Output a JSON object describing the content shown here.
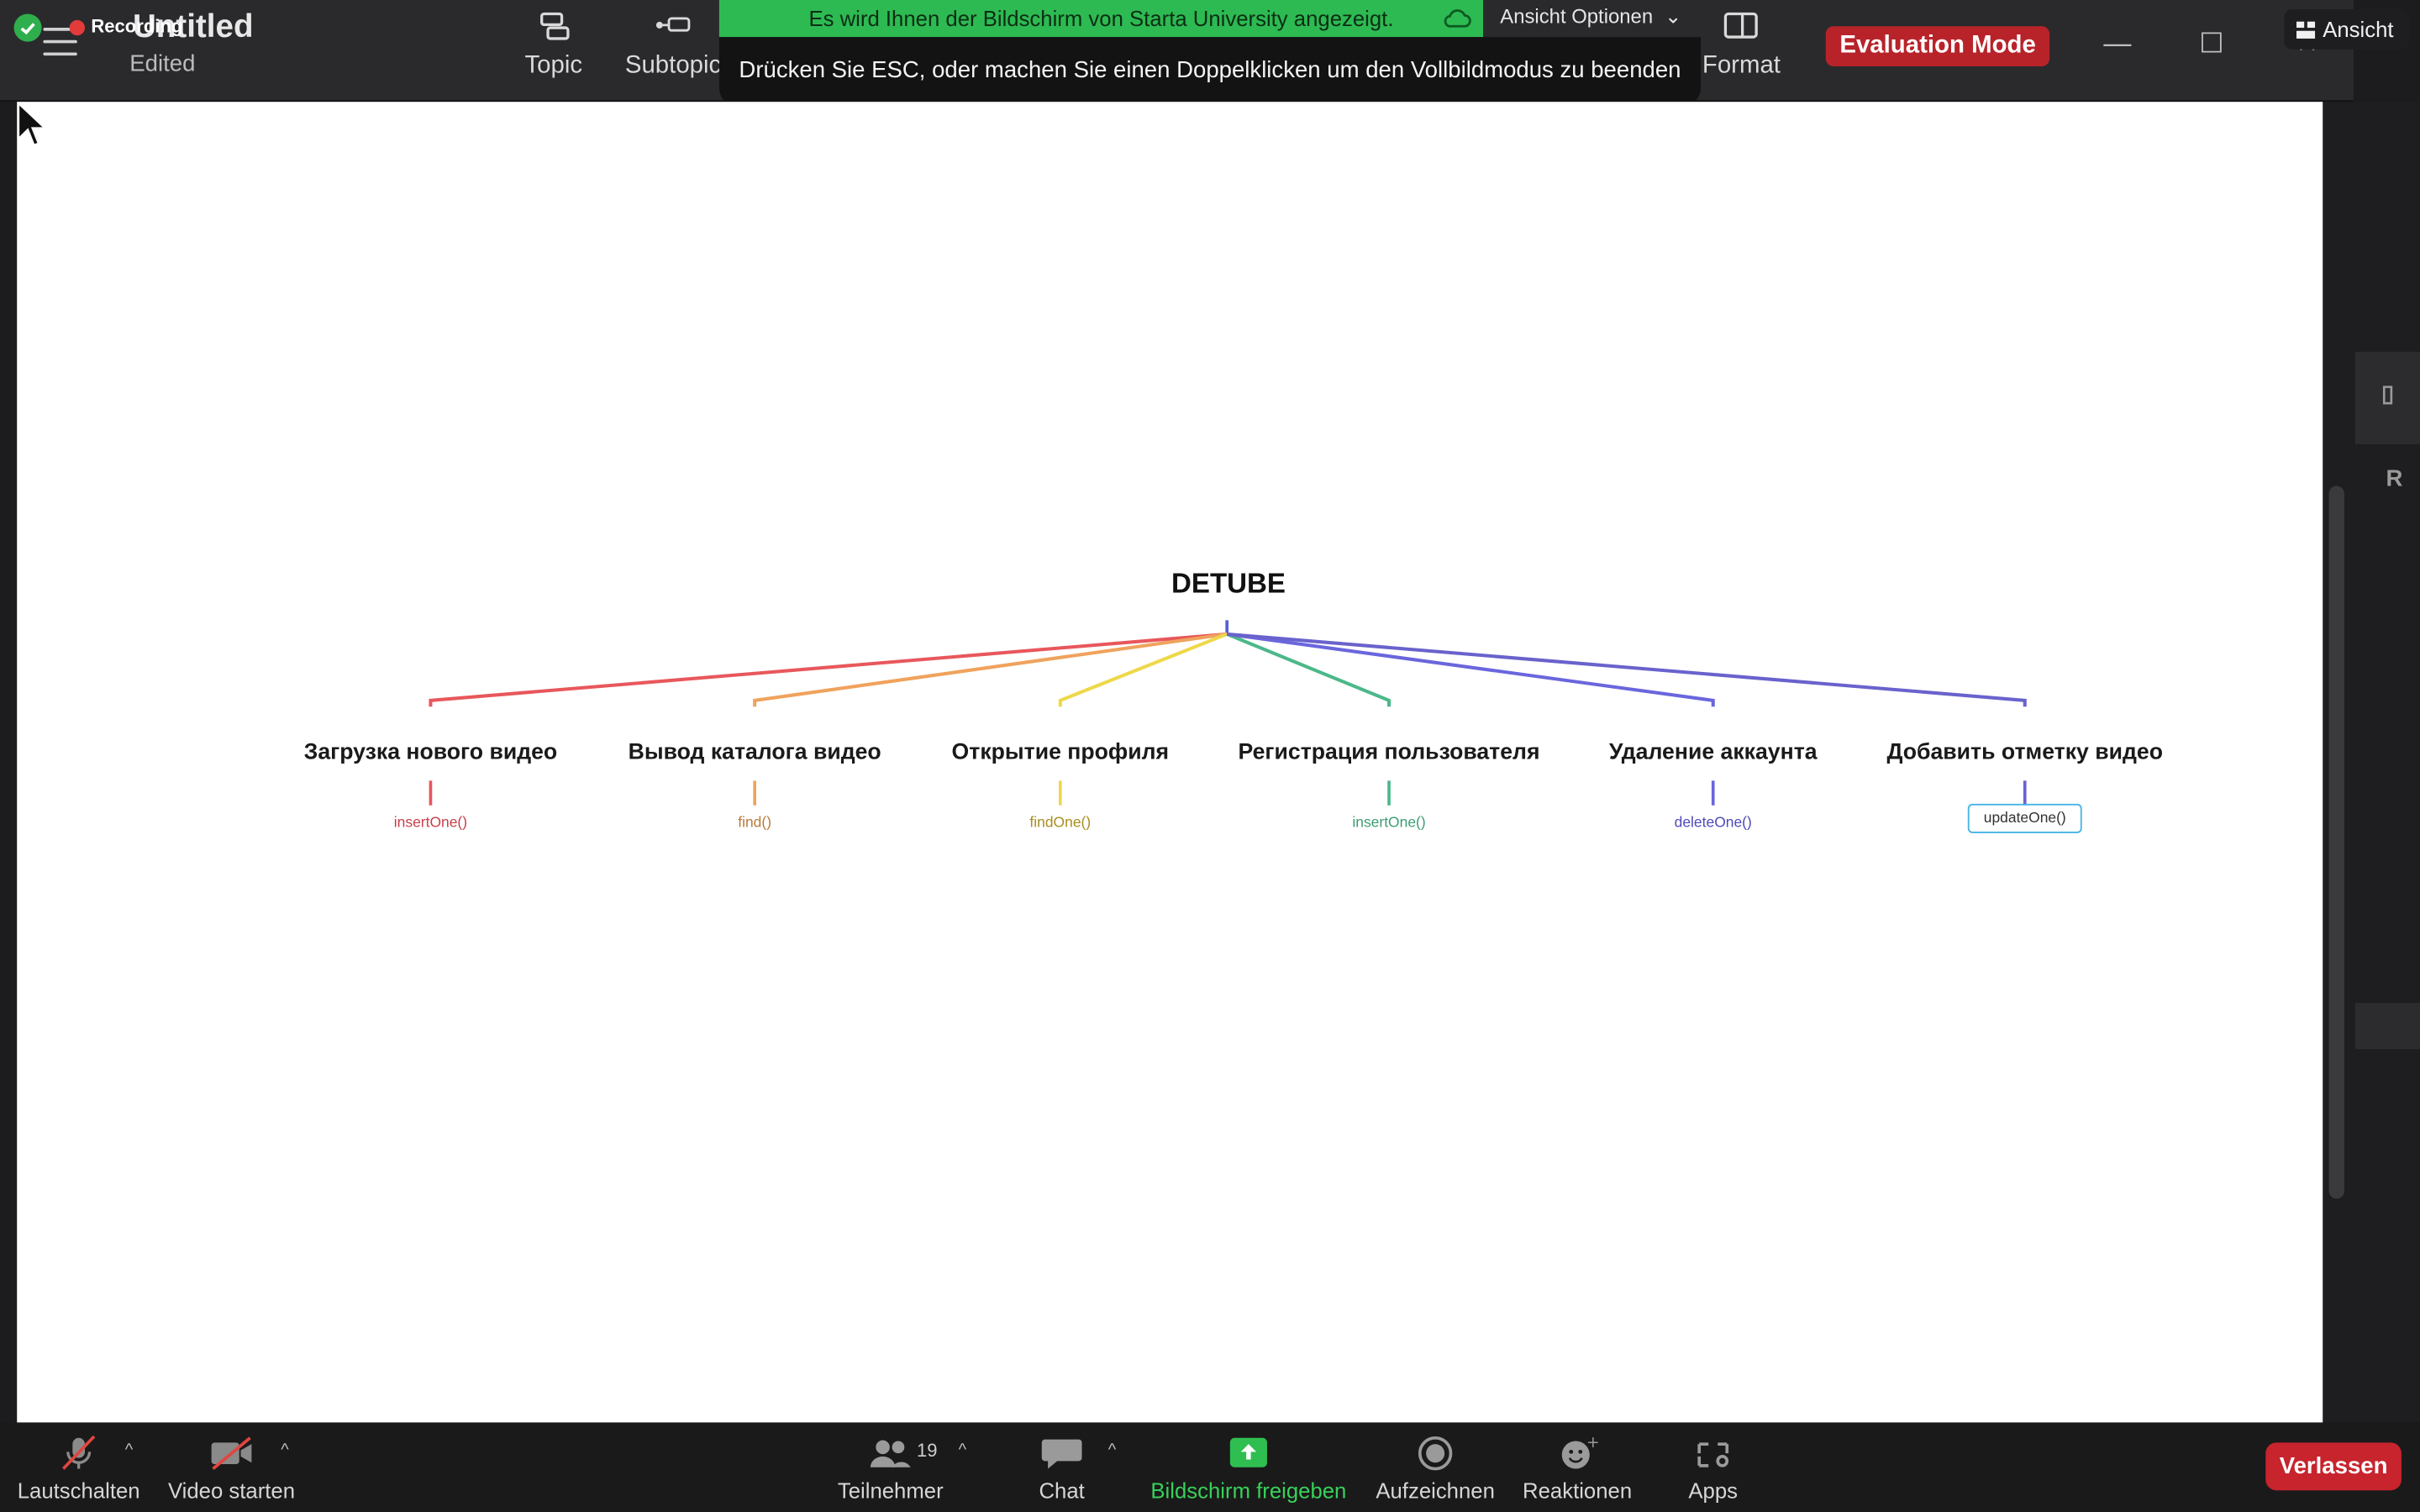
{
  "zoom": {
    "recording_label": "Recording",
    "share_banner": "Es wird Ihnen der Bildschirm von Starta University angezeigt.",
    "view_options": "Ansicht Optionen",
    "esc_tip": "Drücken Sie ESC, oder machen Sie einen Doppelklicken um den Vollbildmodus zu beenden",
    "ansicht": "Ansicht",
    "toolbar": {
      "mute": "Lautschalten",
      "video": "Video starten",
      "participants": "Teilnehmer",
      "participant_count": "19",
      "chat": "Chat",
      "share": "Bildschirm freigeben",
      "record": "Aufzeichnen",
      "reactions": "Reaktionen",
      "apps": "Apps",
      "leave": "Verlassen"
    }
  },
  "app": {
    "doc_title": "Untitled",
    "doc_status": "Edited",
    "tools": {
      "topic": "Topic",
      "subtopic": "Subtopic",
      "format": "Format"
    },
    "evaluation_mode": "Evaluation Mode"
  },
  "mindmap": {
    "root": "DETUBE",
    "branches": [
      {
        "label": "Загрузка нового видео",
        "leaf": "insertOne()",
        "color": "#e8575c"
      },
      {
        "label": "Вывод каталога видео",
        "leaf": "find()",
        "color": "#f0a25c"
      },
      {
        "label": "Открытие профиля",
        "leaf": "findOne()",
        "color": "#eed84a"
      },
      {
        "label": "Регистрация пользователя",
        "leaf": "insertOne()",
        "color": "#4bb88a"
      },
      {
        "label": "Удаление аккаунта",
        "leaf": "deleteOne()",
        "color": "#6a66dd"
      },
      {
        "label": "Добавить отметку видео",
        "leaf": "updateOne()",
        "color": "#6a62cc"
      }
    ]
  }
}
